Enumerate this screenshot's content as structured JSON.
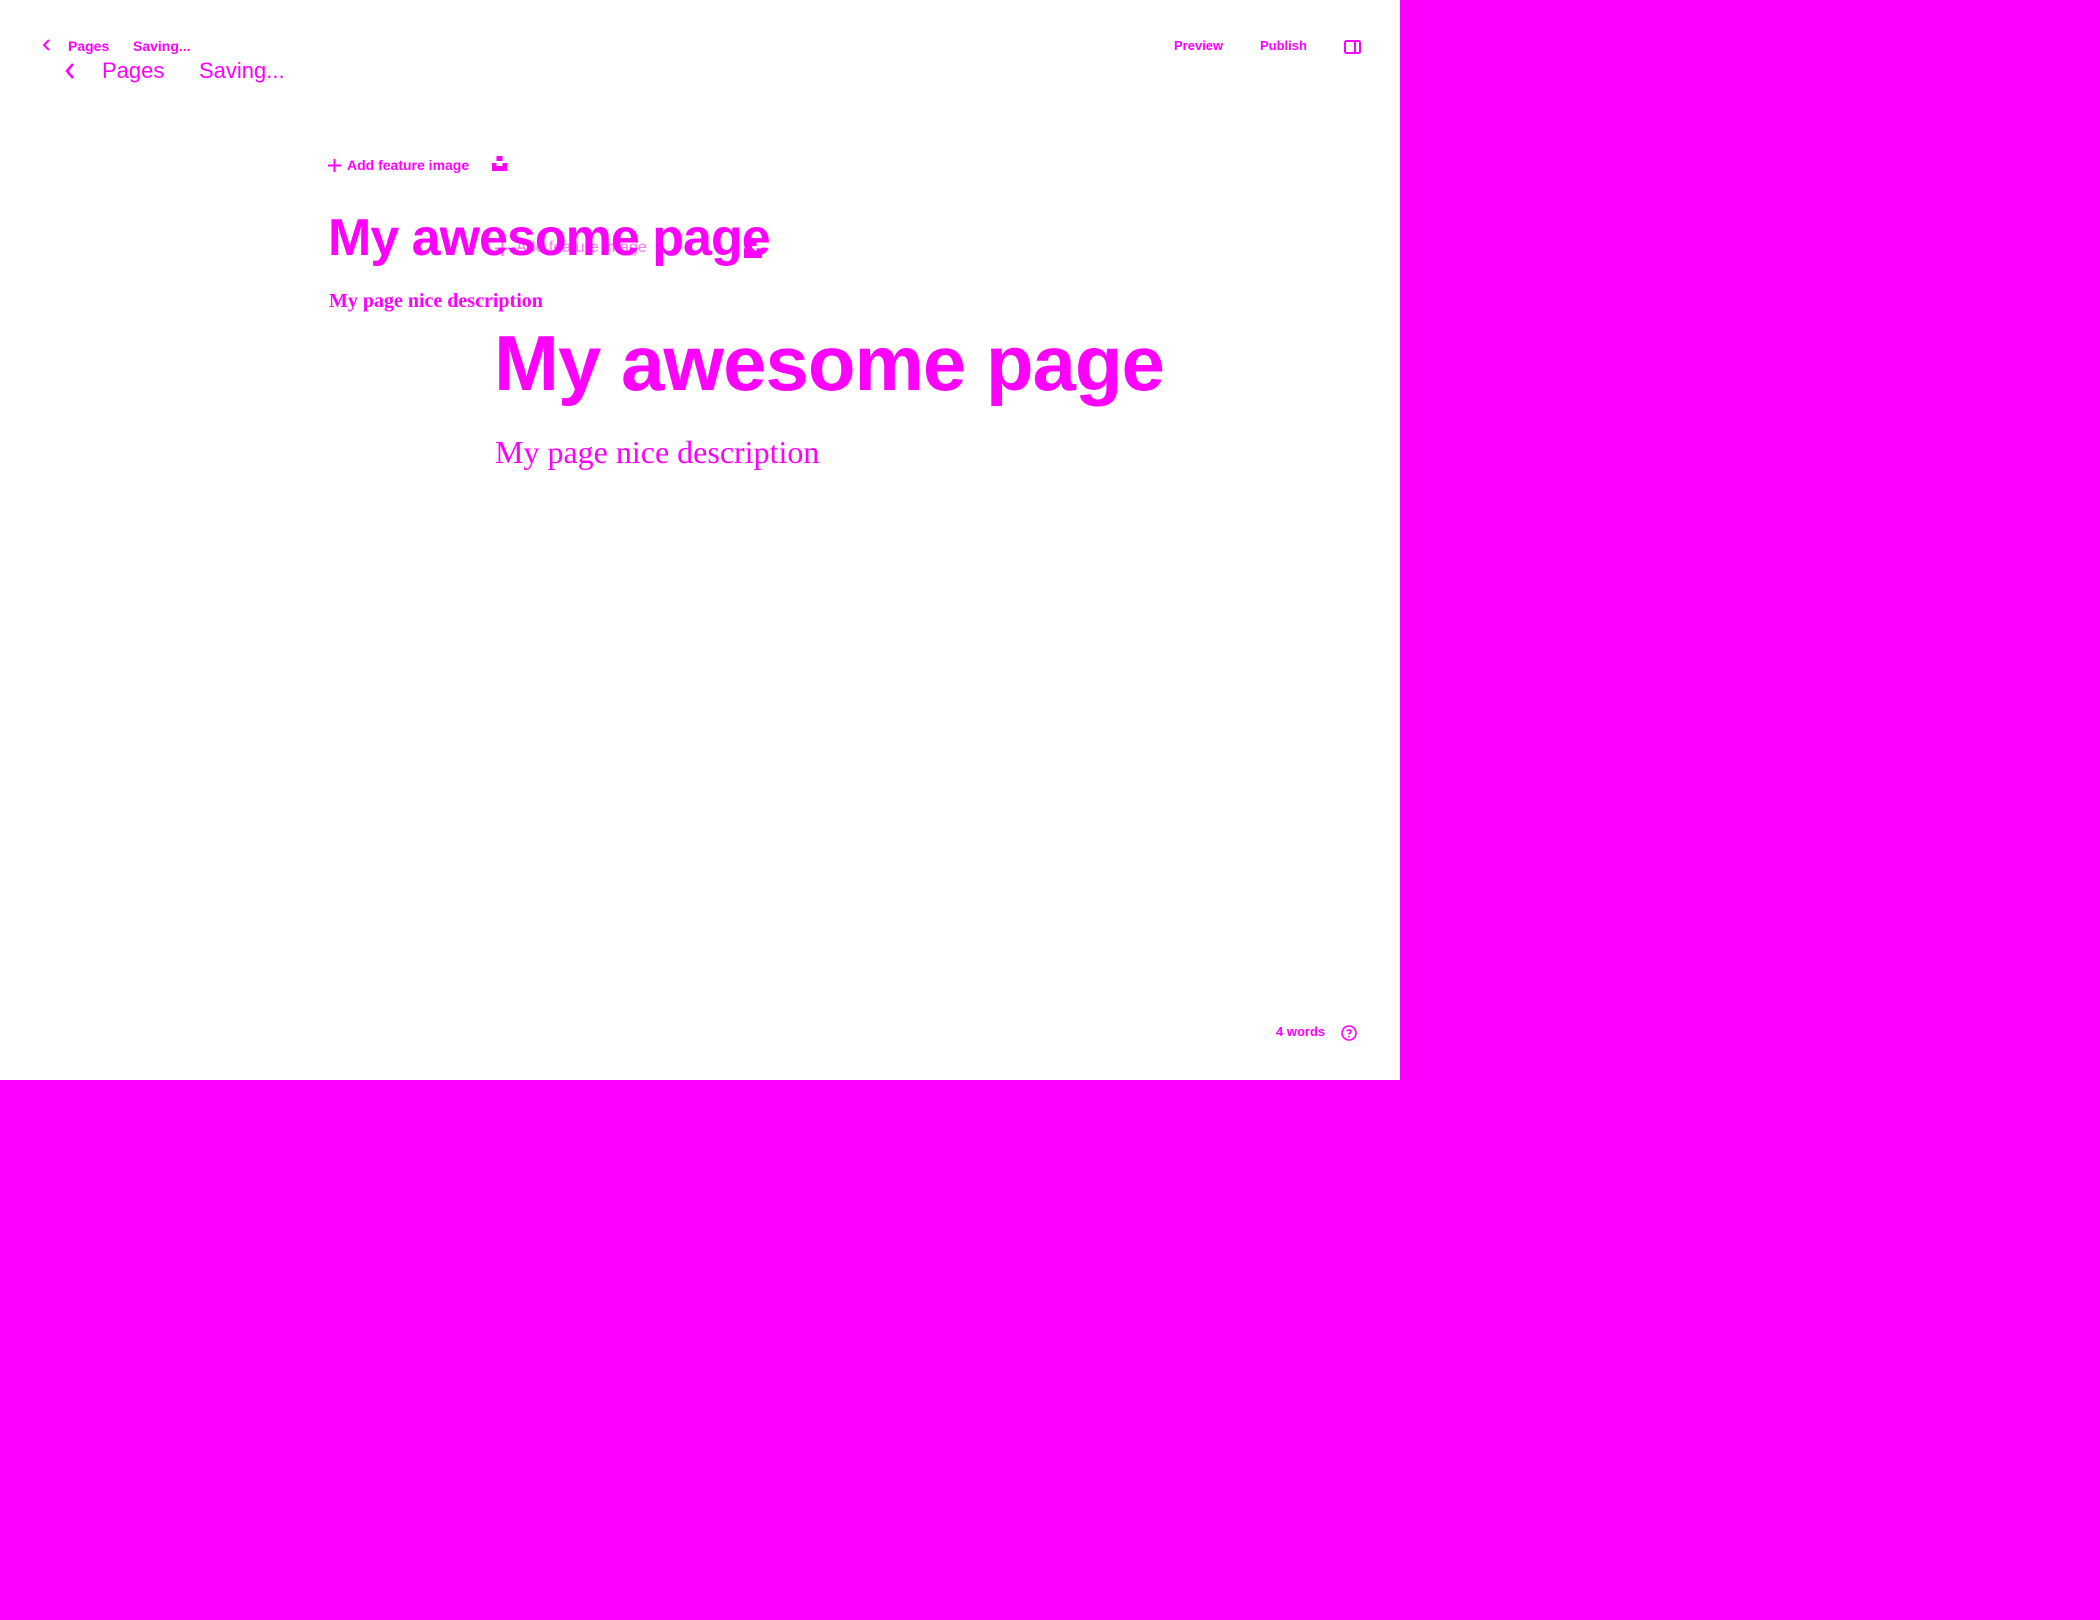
{
  "colors": {
    "accent": "#ff00ff",
    "canvas": "#ffffff"
  },
  "header": {
    "back_icon": "chevron-left-icon",
    "breadcrumb_label": "Pages",
    "status_text": "Saving...",
    "preview_label": "Preview",
    "publish_label": "Publish",
    "sidebar_toggle_icon": "sidebar-toggle-icon"
  },
  "editor": {
    "add_feature_image_label": "Add feature image",
    "add_icon": "plus-icon",
    "unsplash_icon": "unsplash-icon",
    "title": "My awesome page",
    "excerpt": "My page nice description"
  },
  "footer": {
    "word_count": "4 words",
    "help_icon": "question-circle-icon"
  }
}
